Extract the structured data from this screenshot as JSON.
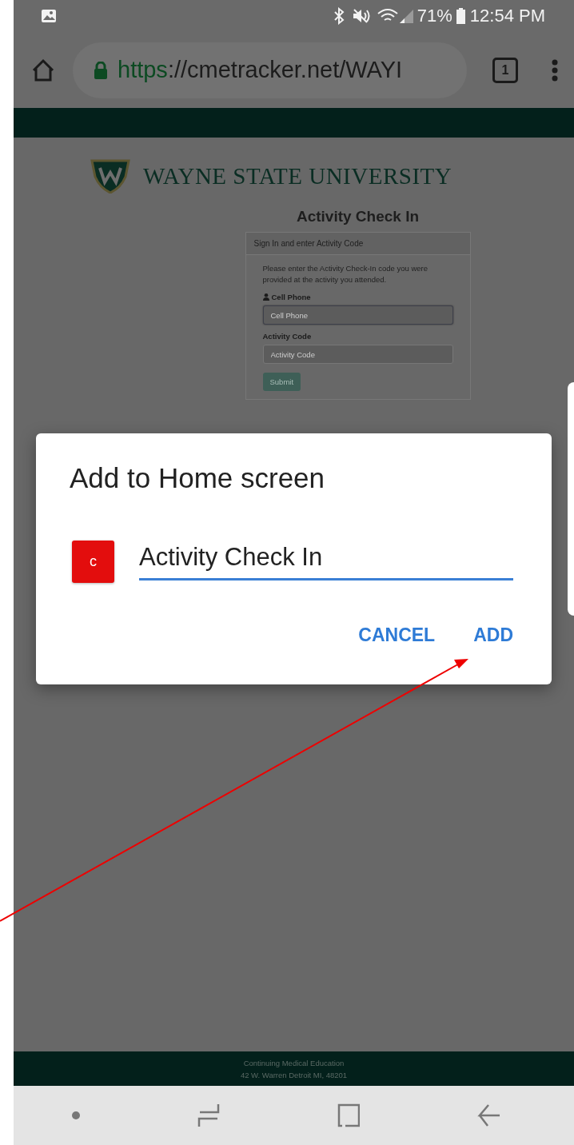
{
  "status_bar": {
    "battery": "71%",
    "time": "12:54 PM"
  },
  "browser": {
    "url_scheme": "https",
    "url_rest": "://cmetracker.net/WAYI",
    "tab_count": "1"
  },
  "page": {
    "brand": "WAYNE STATE UNIVERSITY",
    "title": "Activity Check In",
    "card_header": "Sign In and enter Activity Code",
    "intro": "Please enter the Activity Check-In code you were provided at the activity you attended.",
    "fields": [
      {
        "label": "Cell Phone",
        "placeholder": "Cell Phone",
        "focused": true
      },
      {
        "label": "Activity Code",
        "placeholder": "Activity Code",
        "focused": false
      }
    ],
    "submit": "Submit",
    "footer": [
      "Continuing Medical Education",
      "42 W. Warren Detroit MI, 48201"
    ]
  },
  "dialog": {
    "title": "Add to Home screen",
    "icon_letter": "c",
    "value": "Activity Check In",
    "buttons": [
      "CANCEL",
      "ADD"
    ]
  }
}
